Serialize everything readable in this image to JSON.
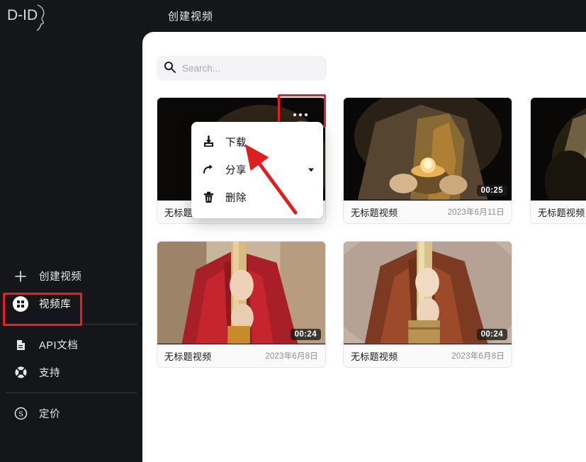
{
  "brand": {
    "logo_text": "D-ID",
    "logo_name": "d-id-logo"
  },
  "header": {
    "title": "创建视频"
  },
  "sidebar": {
    "items": [
      {
        "label": "创建视频",
        "icon": "plus-icon",
        "active": false
      },
      {
        "label": "视频库",
        "icon": "grid-icon",
        "active": true
      },
      {
        "label": "API文档",
        "icon": "document-icon",
        "active": false
      },
      {
        "label": "支持",
        "icon": "lifebuoy-icon",
        "active": false
      },
      {
        "label": "定价",
        "icon": "dollar-circle-icon",
        "active": false
      }
    ]
  },
  "search": {
    "placeholder": "Search...",
    "value": "",
    "icon": "search-icon"
  },
  "videos": [
    {
      "title": "无标题",
      "date": "",
      "duration": "",
      "art": "dark-robe"
    },
    {
      "title": "无标题视频",
      "date": "2023年6月11日",
      "duration": "00:25",
      "art": "lamp-bowl"
    },
    {
      "title": "无标题视频",
      "date": "",
      "duration": "",
      "art": "dark-robe2"
    },
    {
      "title": "无标题视频",
      "date": "2023年6月8日",
      "duration": "00:24",
      "art": "red-robe"
    },
    {
      "title": "无标题视频",
      "date": "2023年6月8日",
      "duration": "00:24",
      "art": "brown-robe"
    }
  ],
  "context_menu": {
    "items": [
      {
        "label": "下载",
        "icon": "download-icon",
        "has_caret": false
      },
      {
        "label": "分享",
        "icon": "share-icon",
        "has_caret": true
      },
      {
        "label": "删除",
        "icon": "trash-icon",
        "has_caret": false
      }
    ]
  },
  "annotations": {
    "highlight_color": "#ee1c25",
    "arrow_color": "#e02020",
    "targets": [
      "sidebar-item-视频库",
      "card-menu-button",
      "download-menu-item"
    ]
  },
  "colors": {
    "sidebar_bg": "#15161a",
    "panel_bg": "#ffffff",
    "accent_red": "#ee1c25"
  }
}
